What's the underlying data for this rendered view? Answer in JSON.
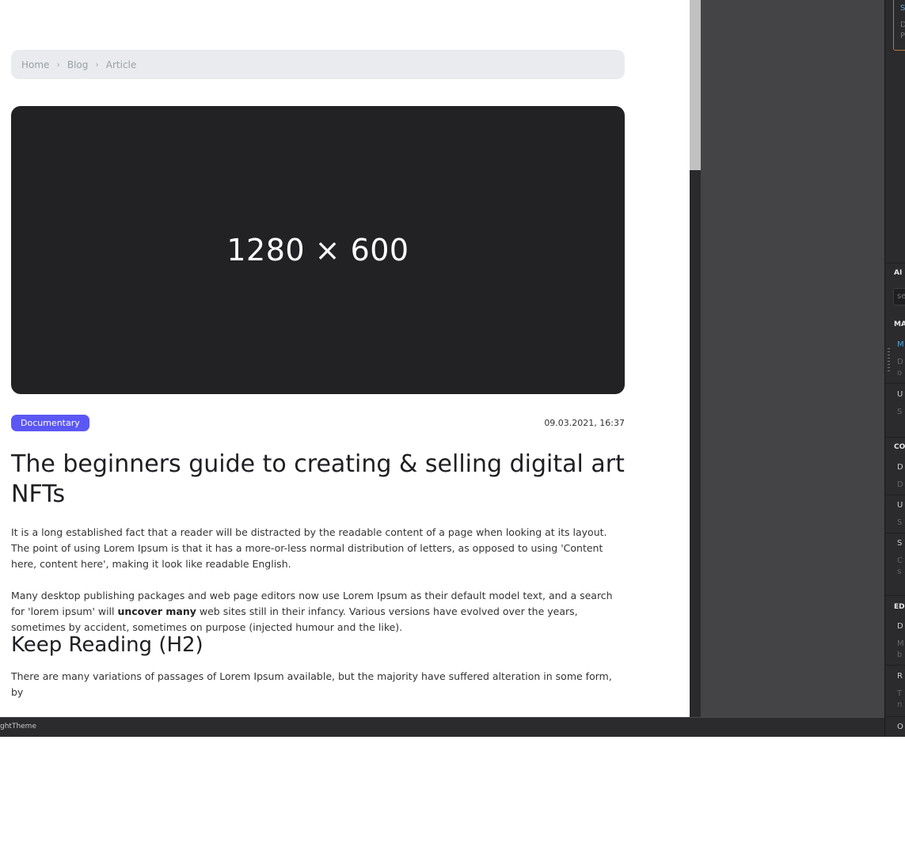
{
  "breadcrumb": {
    "home": "Home",
    "blog": "Blog",
    "article": "Article",
    "separator": "›"
  },
  "hero": {
    "placeholder_text": "1280 × 600"
  },
  "article": {
    "category": "Documentary",
    "date": "09.03.2021, 16:37",
    "title": "The beginners guide to creating & selling digital art NFTs",
    "para1": "It is a long established fact that a reader will be distracted by the readable content of a page when looking at its layout. The point of using Lorem Ipsum is that it has a more-or-less normal distribution of letters, as opposed to using 'Content here, content here', making it look like readable English.",
    "para2_before": "Many desktop publishing packages and web page editors now use Lorem Ipsum as their default model text, and a search for 'lorem ipsum' will ",
    "para2_bold": "uncover many",
    "para2_after": " web sites still in their infancy. Various versions have evolved over the years, sometimes by accident, sometimes on purpose (injected humour and the like).",
    "h2": "Keep Reading (H2)",
    "para3": "There are many variations of passages of Lorem Ipsum available, but the majority have suffered alteration in some form, by"
  },
  "statusbar": {
    "label": "ghtTheme"
  },
  "right_panel": {
    "card_title": "S",
    "card_line1": "D",
    "card_line2": "P",
    "search_placeholder": "se",
    "sections": [
      {
        "heading": "AI"
      },
      {
        "heading": "MA"
      },
      {
        "heading": "CO"
      },
      {
        "heading": "EDI"
      }
    ],
    "items": [
      "M",
      "D",
      "o",
      "U",
      "S",
      "D",
      "D",
      "U",
      "S",
      "S",
      "C",
      "s",
      "D",
      "M",
      "b",
      "R",
      "T",
      "n",
      "O"
    ]
  },
  "colors": {
    "badge": "#5b57f5",
    "hero": "#222225",
    "breadcrumb_bg": "#e9ebee",
    "panel_link": "#4fa3e0"
  }
}
